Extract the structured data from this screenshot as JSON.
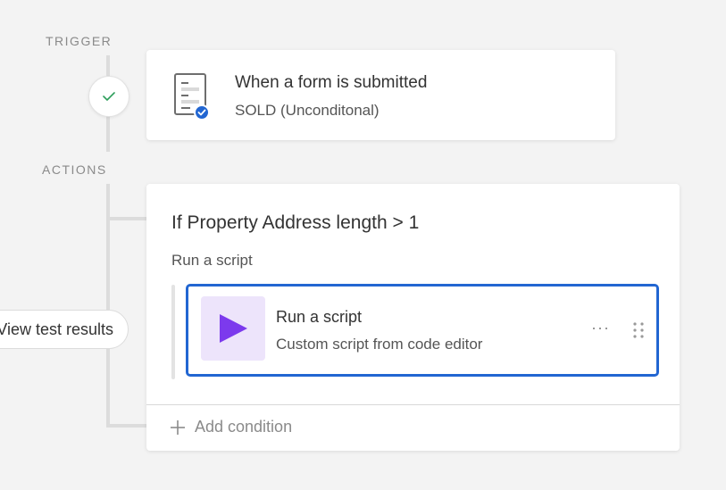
{
  "flow": {
    "trigger_label": "TRIGGER",
    "actions_label": "ACTIONS"
  },
  "trigger": {
    "title": "When a form is submitted",
    "subtitle": "SOLD (Unconditonal)",
    "icon": "form-document-icon",
    "status_icon": "checkmark-icon"
  },
  "condition": {
    "title": "If Property Address length > 1",
    "branch_label": "Run a script",
    "add_condition_label": "Add condition"
  },
  "script_action": {
    "title": "Run a script",
    "subtitle": "Custom script from code editor",
    "more_label": "···",
    "icon": "play-icon"
  },
  "view_results_label": "View test results",
  "colors": {
    "accent_blue": "#2266d2",
    "play_purple": "#7c3aed",
    "play_tile_bg": "#ede4fb",
    "check_green": "#2e9e5b"
  }
}
